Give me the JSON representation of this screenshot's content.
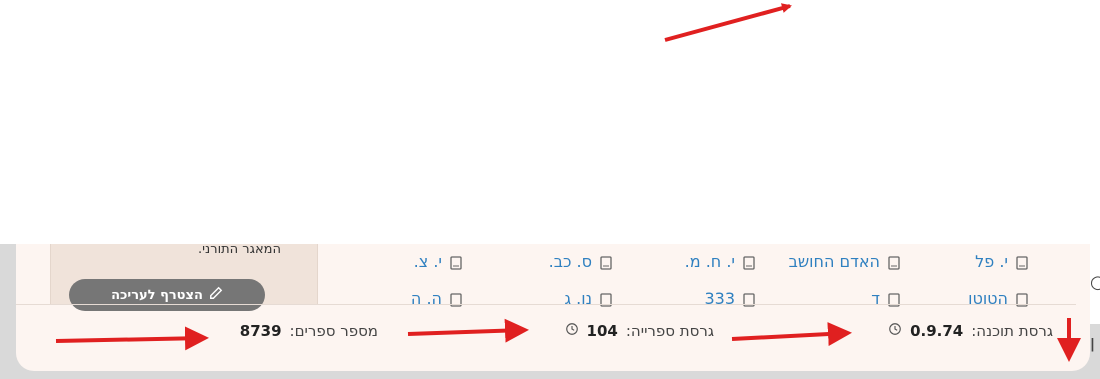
{
  "side_panel": {
    "description_fragment": "המאגר התורני.",
    "join_button_label": "הצטרף לעריכה"
  },
  "books_row1": [
    "י. פל",
    "האדם החושב",
    "י. ח. מ.",
    "ס. כב.",
    "י. צ."
  ],
  "books_row2": [
    "הטוטו",
    "ד",
    "333",
    "נו. ג",
    "ה. ה"
  ],
  "status_bar": {
    "software_version_label": "גרסת תוכנה:",
    "software_version_value": "0.9.74",
    "library_version_label": "גרסת ספרייה:",
    "library_version_value": "104",
    "book_count_label": "מספר ספרים:",
    "book_count_value": "8739"
  },
  "colors": {
    "accent_link": "#2f80c0",
    "card_bg": "#fdf5f1",
    "arrow": "#e02020"
  },
  "icons": [
    "book-icon",
    "pencil-icon",
    "history-icon"
  ]
}
